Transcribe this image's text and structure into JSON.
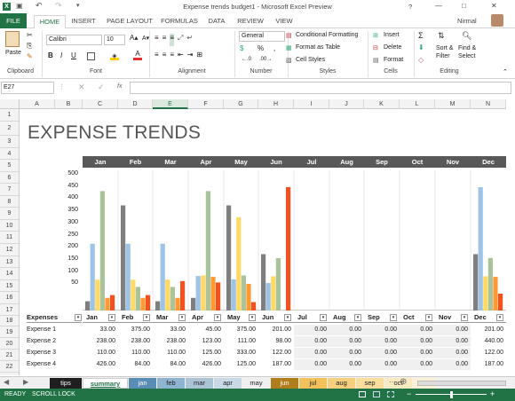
{
  "window": {
    "title": "Expense trends budget1 - Microsoft Excel Preview",
    "user": "Nirmal",
    "controls": [
      "?",
      "—",
      "□",
      "✕"
    ]
  },
  "ribbon_tabs": [
    "FILE",
    "HOME",
    "INSERT",
    "PAGE LAYOUT",
    "FORMULAS",
    "DATA",
    "REVIEW",
    "VIEW"
  ],
  "ribbon": {
    "paste": "Paste",
    "clipboard": "Clipboard",
    "font_name": "Calibri",
    "font_size": "10",
    "font": "Font",
    "alignment": "Alignment",
    "number_format": "General",
    "number": "Number",
    "conditional": "Conditional Formatting",
    "format_table": "Format as Table",
    "cell_styles": "Cell Styles",
    "styles": "Styles",
    "insert": "Insert",
    "delete": "Delete",
    "format": "Format",
    "cells": "Cells",
    "sort_filter": "Sort &",
    "sort_filter2": "Filter",
    "find_select": "Find &",
    "find_select2": "Select",
    "editing": "Editing"
  },
  "formula_bar": {
    "name_box": "E27",
    "fx": "fx",
    "value": ""
  },
  "columns": [
    "A",
    "B",
    "C",
    "D",
    "E",
    "F",
    "G",
    "H",
    "I",
    "J",
    "K",
    "L",
    "M",
    "N"
  ],
  "rows": [
    "1",
    "2",
    "3",
    "4",
    "5",
    "6",
    "7",
    "8",
    "9",
    "10",
    "11",
    "12",
    "13",
    "14",
    "15",
    "16",
    "17",
    "18",
    "19",
    "20",
    "21",
    "22",
    "23"
  ],
  "sheet_title": "EXPENSE TRENDS",
  "months": [
    "Jan",
    "Feb",
    "Mar",
    "Apr",
    "May",
    "Jun",
    "Jul",
    "Aug",
    "Sep",
    "Oct",
    "Nov",
    "Dec"
  ],
  "table": {
    "header": "Expenses",
    "rows": [
      {
        "label": "Expense 1",
        "values": [
          "33.00",
          "375.00",
          "33.00",
          "45.00",
          "375.00",
          "201.00",
          "0.00",
          "0.00",
          "0.00",
          "0.00",
          "0.00",
          "201.00"
        ]
      },
      {
        "label": "Expense 2",
        "values": [
          "238.00",
          "238.00",
          "238.00",
          "123.00",
          "111.00",
          "98.00",
          "0.00",
          "0.00",
          "0.00",
          "0.00",
          "0.00",
          "440.00"
        ]
      },
      {
        "label": "Expense 3",
        "values": [
          "110.00",
          "110.00",
          "110.00",
          "125.00",
          "333.00",
          "122.00",
          "0.00",
          "0.00",
          "0.00",
          "0.00",
          "0.00",
          "122.00"
        ]
      },
      {
        "label": "Expense 4",
        "values": [
          "426.00",
          "84.00",
          "84.00",
          "426.00",
          "125.00",
          "187.00",
          "0.00",
          "0.00",
          "0.00",
          "0.00",
          "0.00",
          "187.00"
        ]
      }
    ]
  },
  "chart_data": {
    "type": "bar",
    "categories": [
      "Jan",
      "Feb",
      "Mar",
      "Apr",
      "May",
      "Jun",
      "Jul",
      "Aug",
      "Sep",
      "Oct",
      "Nov",
      "Dec"
    ],
    "y_ticks": [
      "500",
      "450",
      "400",
      "350",
      "300",
      "250",
      "200",
      "150",
      "100",
      "50"
    ],
    "ylim": [
      0,
      500
    ],
    "colors": [
      "#7f7f7f",
      "#9dc3e6",
      "#ffd966",
      "#a9c49a",
      "#ff9933",
      "#f4511e"
    ],
    "series": [
      {
        "values": [
          33,
          375,
          33,
          45,
          375,
          201,
          0,
          0,
          0,
          0,
          0,
          201
        ]
      },
      {
        "values": [
          238,
          238,
          238,
          123,
          111,
          98,
          0,
          0,
          0,
          0,
          0,
          440
        ]
      },
      {
        "values": [
          110,
          110,
          110,
          125,
          333,
          122,
          0,
          0,
          0,
          0,
          0,
          122
        ]
      },
      {
        "values": [
          426,
          84,
          84,
          426,
          125,
          187,
          0,
          0,
          0,
          0,
          0,
          187
        ]
      },
      {
        "values": [
          45,
          45,
          45,
          120,
          95,
          0,
          0,
          0,
          0,
          0,
          0,
          120
        ]
      },
      {
        "values": [
          55,
          55,
          105,
          100,
          30,
          440,
          0,
          0,
          0,
          0,
          0,
          60
        ]
      }
    ]
  },
  "sheet_tabs": [
    {
      "label": "tips",
      "bg": "#1f1f1f",
      "fg": "#ffffff"
    },
    {
      "label": "summary",
      "bg": "#ffffff",
      "fg": "#217346"
    },
    {
      "label": "jan",
      "bg": "#5a8db3",
      "fg": "#ffffff"
    },
    {
      "label": "feb",
      "bg": "#8fb4cf",
      "fg": "#222222"
    },
    {
      "label": "mar",
      "bg": "#aac4d6",
      "fg": "#222222"
    },
    {
      "label": "apr",
      "bg": "#c8d8e4",
      "fg": "#222222"
    },
    {
      "label": "may",
      "bg": "#f0f0f0",
      "fg": "#222222"
    },
    {
      "label": "jun",
      "bg": "#b07d1c",
      "fg": "#ffffff"
    },
    {
      "label": "jul",
      "bg": "#f2c15c",
      "fg": "#222222"
    },
    {
      "label": "aug",
      "bg": "#f5cf7d",
      "fg": "#222222"
    },
    {
      "label": "sep",
      "bg": "#f8dd9c",
      "fg": "#222222"
    },
    {
      "label": "oct",
      "bg": "#faeac0",
      "fg": "#222222"
    },
    {
      "label": "no",
      "bg": "#fbf0d4",
      "fg": "#222222"
    }
  ],
  "status": {
    "ready": "READY",
    "scroll_lock": "SCROLL LOCK",
    "zoom_minus": "−",
    "zoom_plus": "+"
  }
}
